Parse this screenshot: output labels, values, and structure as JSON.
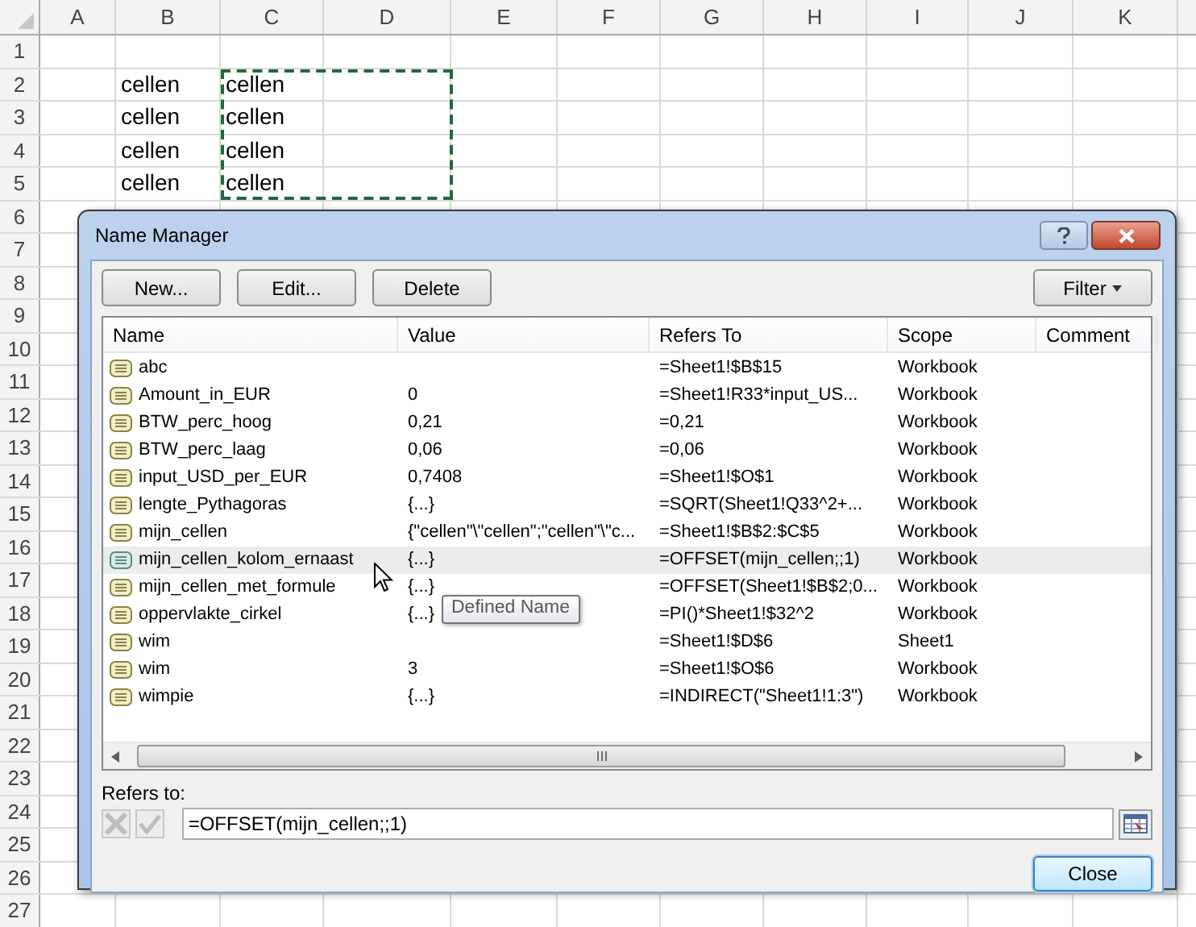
{
  "sheet": {
    "columns": [
      "A",
      "B",
      "C",
      "D",
      "E",
      "F",
      "G",
      "H",
      "I",
      "J",
      "K"
    ],
    "rows": [
      {
        "label": "1"
      },
      {
        "label": "2",
        "cells": {
          "B": "cellen",
          "C": "cellen"
        }
      },
      {
        "label": "3",
        "cells": {
          "B": "cellen",
          "C": "cellen"
        }
      },
      {
        "label": "4",
        "cells": {
          "B": "cellen",
          "C": "cellen"
        }
      },
      {
        "label": "5",
        "cells": {
          "B": "cellen",
          "C": "cellen"
        }
      },
      {
        "label": "6"
      },
      {
        "label": "7"
      },
      {
        "label": "8"
      },
      {
        "label": "9"
      },
      {
        "label": "10"
      },
      {
        "label": "11"
      },
      {
        "label": "12"
      },
      {
        "label": "13"
      },
      {
        "label": "14"
      },
      {
        "label": "15"
      },
      {
        "label": "16"
      },
      {
        "label": "17"
      },
      {
        "label": "18"
      },
      {
        "label": "19"
      },
      {
        "label": "20"
      },
      {
        "label": "21"
      },
      {
        "label": "22"
      },
      {
        "label": "23"
      },
      {
        "label": "24"
      },
      {
        "label": "25"
      },
      {
        "label": "26"
      },
      {
        "label": "27"
      }
    ]
  },
  "dialog": {
    "title": "Name Manager",
    "buttons": [
      "New...",
      "Edit...",
      "Delete"
    ],
    "filter_button": "Filter",
    "table": {
      "columns": [
        "Name",
        "Value",
        "Refers To",
        "Scope",
        "Comment"
      ],
      "rows": [
        {
          "name": "abc",
          "refers_to": "=Sheet1!$B$15",
          "scope": "Workbook",
          "selected": false
        },
        {
          "name": "Amount_in_EUR",
          "value": "0",
          "refers_to": "=Sheet1!R33*input_US...",
          "scope": "Workbook",
          "selected": false
        },
        {
          "name": "BTW_perc_hoog",
          "value": "0,21",
          "refers_to": "=0,21",
          "scope": "Workbook",
          "selected": false
        },
        {
          "name": "BTW_perc_laag",
          "value": "0,06",
          "refers_to": "=0,06",
          "scope": "Workbook",
          "selected": false
        },
        {
          "name": "input_USD_per_EUR",
          "value": "0,7408",
          "refers_to": "=Sheet1!$O$1",
          "scope": "Workbook",
          "selected": false
        },
        {
          "name": "lengte_Pythagoras",
          "value": "{...}",
          "refers_to": "=SQRT(Sheet1!Q33^2+...",
          "scope": "Workbook",
          "selected": false
        },
        {
          "name": "mijn_cellen",
          "value": "{\"cellen\"\\\"cellen\";\"cellen\"\\\"c...",
          "refers_to": "=Sheet1!$B$2:$C$5",
          "scope": "Workbook",
          "selected": false
        },
        {
          "name": "mijn_cellen_kolom_ernaast",
          "value": "{...}",
          "refers_to": "=OFFSET(mijn_cellen;;1)",
          "scope": "Workbook",
          "selected": true
        },
        {
          "name": "mijn_cellen_met_formule",
          "value": "{...}",
          "refers_to": "=OFFSET(Sheet1!$B$2;0...",
          "scope": "Workbook",
          "selected": false
        },
        {
          "name": "oppervlakte_cirkel",
          "value": "{...}",
          "refers_to": "=PI()*Sheet1!$32^2",
          "scope": "Workbook",
          "selected": false
        },
        {
          "name": "wim",
          "refers_to": "=Sheet1!$D$6",
          "scope": "Sheet1",
          "selected": false
        },
        {
          "name": "wim",
          "value": "3",
          "refers_to": "=Sheet1!$O$6",
          "scope": "Workbook",
          "selected": false
        },
        {
          "name": "wimpie",
          "value": "{...}",
          "refers_to": "=INDIRECT(\"Sheet1!1:3\")",
          "scope": "Workbook",
          "selected": false
        }
      ]
    },
    "tooltip": "Defined Name",
    "refers_to_label": "Refers to:",
    "refers_to_value": "=OFFSET(mijn_cellen;;1)",
    "close_button": "Close"
  }
}
